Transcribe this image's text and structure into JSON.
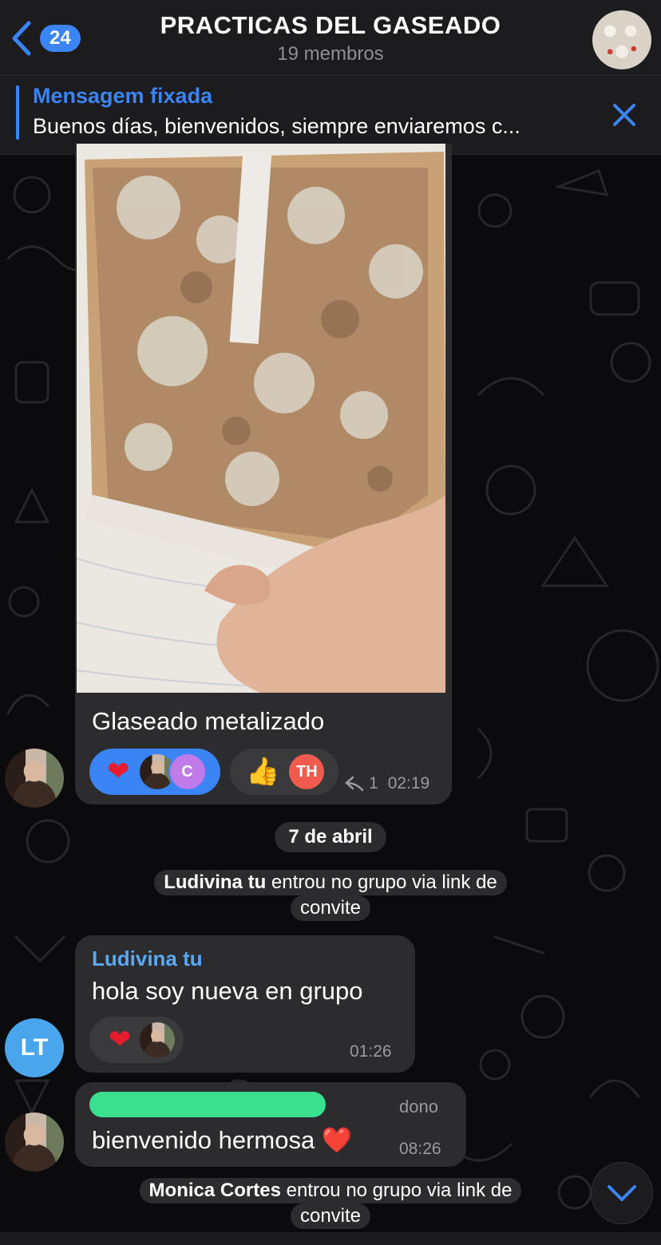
{
  "header": {
    "back_badge": "24",
    "title": "PRACTICAS DEL GASEADO",
    "subtitle": "19 membros"
  },
  "pinned": {
    "label": "Mensagem fixada",
    "text": "Buenos días, bienvenidos, siempre enviaremos c..."
  },
  "messages": {
    "media": {
      "caption": "Glaseado metalizado",
      "reaction_avatar_letter": "C",
      "thumbs_avatar": "TH",
      "reply_count": "1",
      "time": "02:19"
    },
    "date_separator": "7 de abril",
    "join1": {
      "name": "Ludivina tu",
      "text": "entrou no grupo via link de",
      "text2": "convite"
    },
    "ludivina": {
      "sender": "Ludivina tu",
      "text": "hola soy nueva en grupo",
      "time": "01:26",
      "avatar_initials": "LT"
    },
    "owner": {
      "role": "dono",
      "text": "bienvenido hermosa ❤️",
      "time": "08:26"
    },
    "join2": {
      "name": "Monica Cortes",
      "text": "entrou no grupo via link de",
      "text2": "convite"
    }
  },
  "colors": {
    "accent": "#3a84f5",
    "bubble": "#2c2c2e",
    "sender": "#5aa9f5"
  },
  "icons": [
    "chevron-left-icon",
    "close-icon",
    "reply-icon",
    "chevron-down-icon",
    "heart-icon",
    "thumbs-up-icon"
  ]
}
